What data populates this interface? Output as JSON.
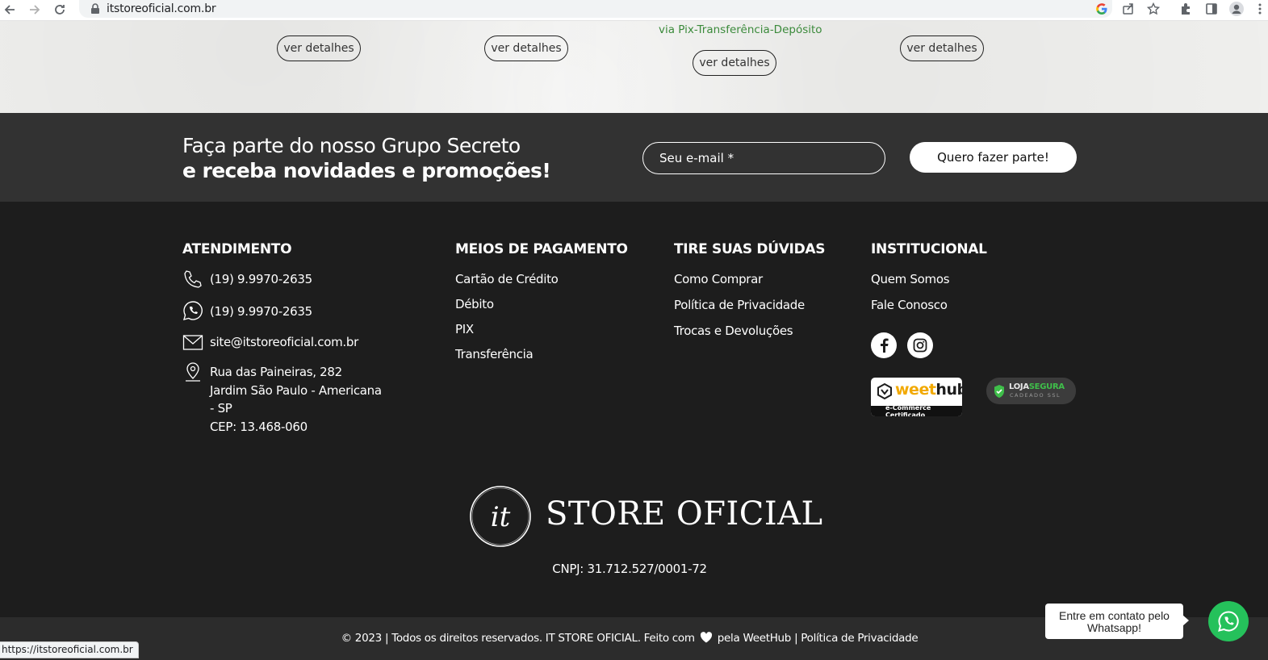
{
  "browser": {
    "url": "itstoreoficial.com.br",
    "status_url": "https://itstoreoficial.com.br"
  },
  "products": {
    "detail_label": "ver detalhes",
    "pix_note": "via Pix-Transferência-Depósito"
  },
  "newsletter": {
    "line1": "Faça parte do nosso Grupo Secreto",
    "line2": "e receba novidades e promoções!",
    "email_placeholder": "Seu e-mail *",
    "submit_label": "Quero fazer parte!"
  },
  "footer": {
    "atendimento": {
      "title": "ATENDIMENTO",
      "phone": "(19) 9.9970-2635",
      "whatsapp": "(19) 9.9970-2635",
      "email": "site@itstoreoficial.com.br",
      "address": [
        "Rua das Paineiras, 282",
        "Jardim São Paulo - Americana - SP",
        "CEP: 13.468-060"
      ]
    },
    "pagamento": {
      "title": "MEIOS DE PAGAMENTO",
      "items": [
        "Cartão de Crédito",
        "Débito",
        "PIX",
        "Transferência"
      ]
    },
    "duvidas": {
      "title": "TIRE SUAS DÚVIDAS",
      "items": [
        "Como Comprar",
        "Política de Privacidade",
        "Trocas e Devoluções"
      ]
    },
    "institucional": {
      "title": "INSTITUCIONAL",
      "items": [
        "Quem Somos",
        "Fale Conosco"
      ]
    },
    "badges": {
      "weethub_a": "weet",
      "weethub_b": "hub",
      "weethub_sub": "e-Commerce Certificado",
      "loja_a": "LOJA",
      "loja_b": "SEGURA",
      "loja_sub": "CADEADO SSL"
    },
    "logo_text": "STORE OFICIAL",
    "logo_mark": "it",
    "cnpj": "CNPJ: 31.712.527/0001-72"
  },
  "bottom": {
    "copyright_a": "© 2023 | Todos os direitos reservados. IT STORE OFICIAL. Feito com",
    "copyright_b": "pela WeetHub | Política de Privacidade"
  },
  "whatsapp": {
    "bubble": "Entre em contato pelo Whatsapp!"
  },
  "colors": {
    "footer_bg": "#1d1d1d",
    "newsletter_bg": "#323232",
    "whatsapp_green": "#25c15b",
    "pix_green": "#3b8a3b"
  }
}
